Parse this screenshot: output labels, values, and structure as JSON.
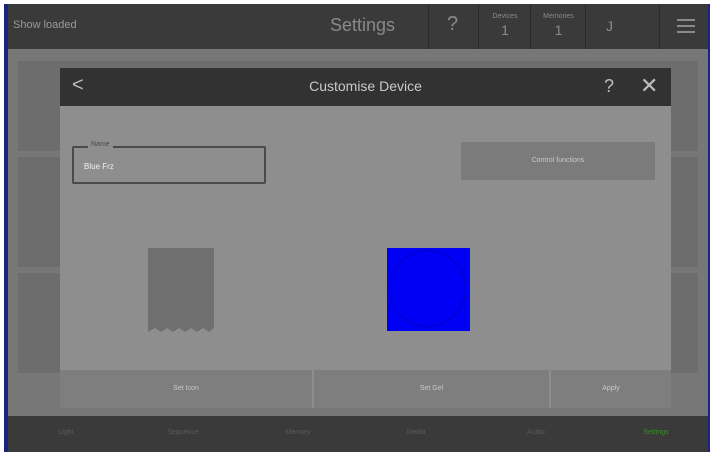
{
  "topbar": {
    "show_label": "Show loaded",
    "title": "Settings",
    "help": "?",
    "devices": {
      "label": "Devices",
      "count": "1"
    },
    "memories": {
      "label": "Memories",
      "count": "1"
    },
    "user": "J",
    "menu_icon": "hamburger-icon"
  },
  "modal": {
    "title": "Customise Device",
    "back": "<",
    "help": "?",
    "close": "✕",
    "name_label": "Name",
    "name_value": "Blue Frz",
    "control_functions": "Control functions",
    "device_icon": "fixture-icon",
    "gel_color": "#0000f5",
    "buttons": {
      "set_icon": "Set Icon",
      "set_gel": "Set Gel",
      "apply": "Apply"
    }
  },
  "bottomnav": {
    "items": [
      "Light",
      "Sequence",
      "Memory",
      "Media",
      "Audio",
      "Settings"
    ],
    "active": "Settings"
  },
  "colors": {
    "accent_active": "#3d8a2e",
    "frame": "#1a237e"
  }
}
